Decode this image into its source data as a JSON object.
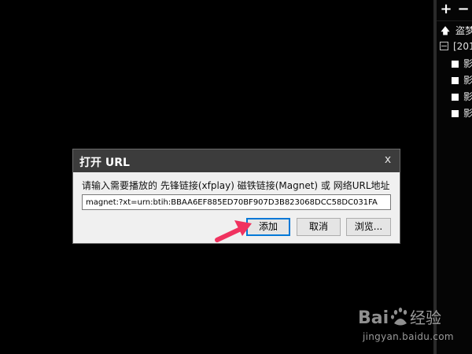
{
  "playlist": {
    "add_label": "+",
    "remove_label": "−",
    "items": [
      {
        "label": "盗梦"
      },
      {
        "label": "[201"
      },
      {
        "label": "影"
      },
      {
        "label": "影"
      },
      {
        "label": "影"
      },
      {
        "label": "影"
      }
    ]
  },
  "dialog": {
    "title": "打开 URL",
    "close_label": "x",
    "prompt": "请输入需要播放的 先锋链接(xfplay) 磁铁链接(Magnet) 或 网络URL地址",
    "url_value": "magnet:?xt=urn:btih:BBAA6EF885ED70BF907D3B823068DCC58DC031FA",
    "buttons": {
      "add": "添加",
      "cancel": "取消",
      "browse": "浏览..."
    }
  },
  "colors": {
    "background": "#000000",
    "dialog_bg": "#f0f0f0",
    "titlebar": "#3c3c3c",
    "arrow": "#f0325f",
    "focus": "#0078d7"
  },
  "watermark": {
    "logo_text": "Bai 经验",
    "url": "jingyan.baidu.com"
  }
}
